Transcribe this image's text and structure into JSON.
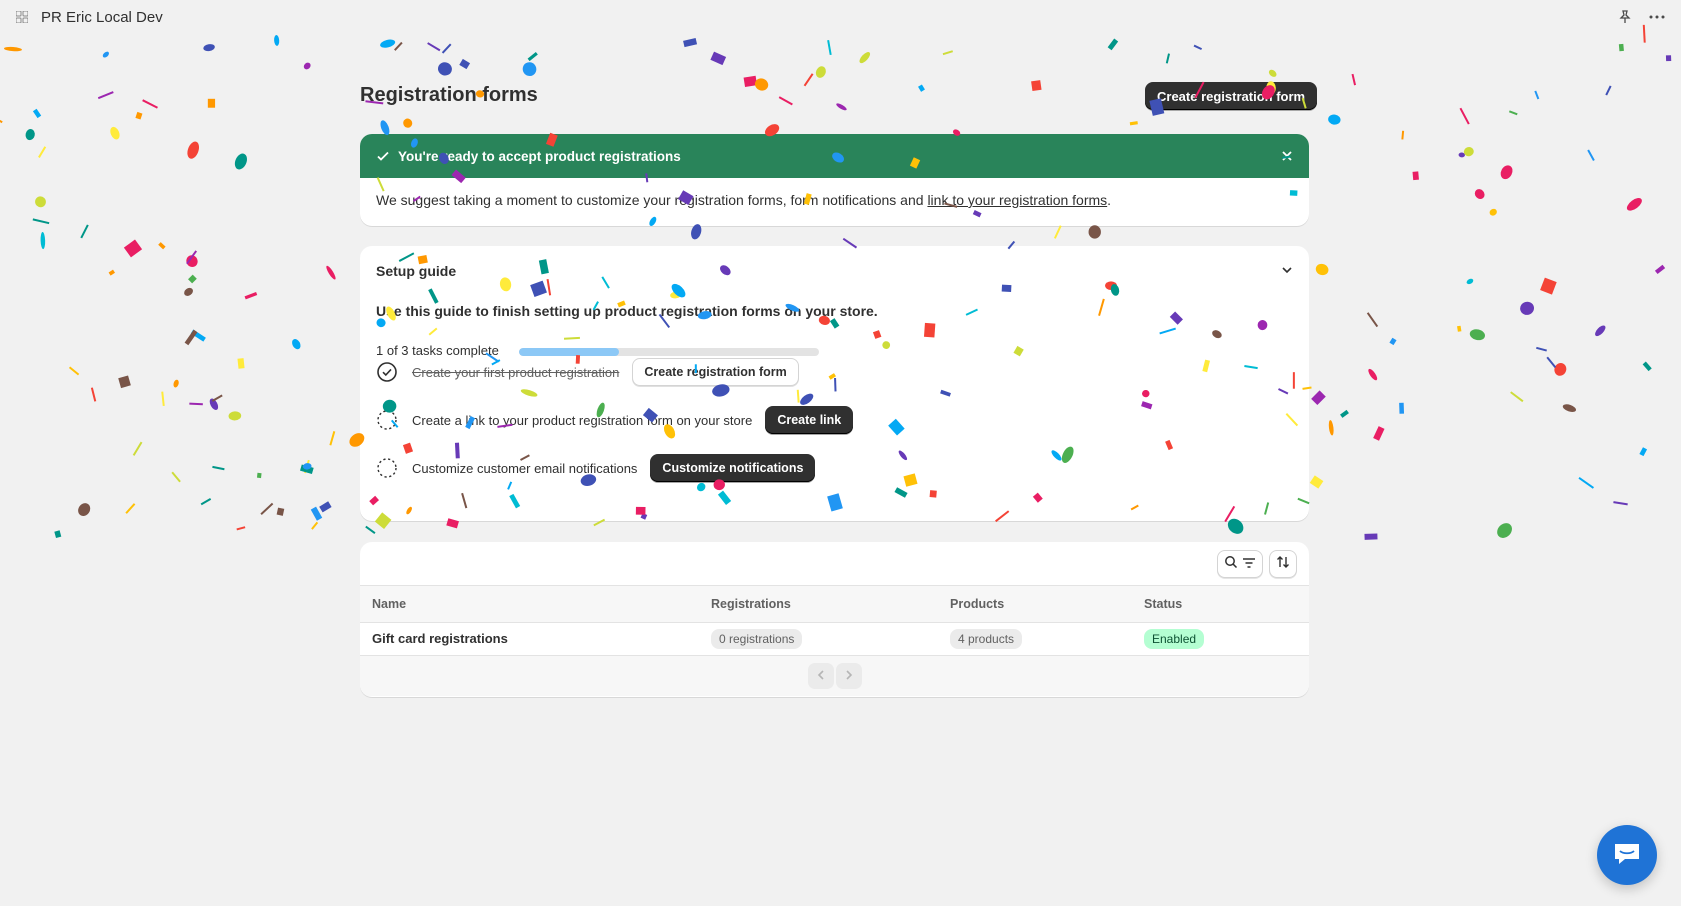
{
  "app": {
    "title": "PR Eric Local Dev",
    "icons": [
      "app-grid-icon",
      "pin-icon",
      "more-horizontal-icon"
    ]
  },
  "page": {
    "title": "Registration forms",
    "primary_action": "Create registration form"
  },
  "banner": {
    "title": "You're ready to accept product registrations",
    "body_prefix": "We suggest taking a moment to customize your registration forms, form notifications and ",
    "link_text": "link to your registration forms",
    "body_suffix": ".",
    "color": "#29845a"
  },
  "setup_guide": {
    "title": "Setup guide",
    "subtitle": "Use this guide to finish setting up product registration forms on your store.",
    "progress_text": "1 of 3 tasks complete",
    "progress": {
      "completed": 1,
      "total": 3
    },
    "tasks": [
      {
        "label": "Create your first product registration",
        "done": true,
        "button": "Create registration form"
      },
      {
        "label": "Create a link to your product registration form on your store",
        "done": false,
        "button": "Create link"
      },
      {
        "label": "Customize customer email notifications",
        "done": false,
        "button": "Customize notifications"
      }
    ]
  },
  "table": {
    "columns": [
      "Name",
      "Registrations",
      "Products",
      "Status"
    ],
    "rows": [
      {
        "name": "Gift card registrations",
        "registrations": "0 registrations",
        "products": "4 products",
        "status": "Enabled"
      }
    ]
  },
  "colors": {
    "accent_dark": "#303030",
    "success_green": "#29845a",
    "status_enabled_bg": "#b4fed2",
    "progress_fill": "#8cc8f6",
    "chat_button": "#1f73d6"
  }
}
